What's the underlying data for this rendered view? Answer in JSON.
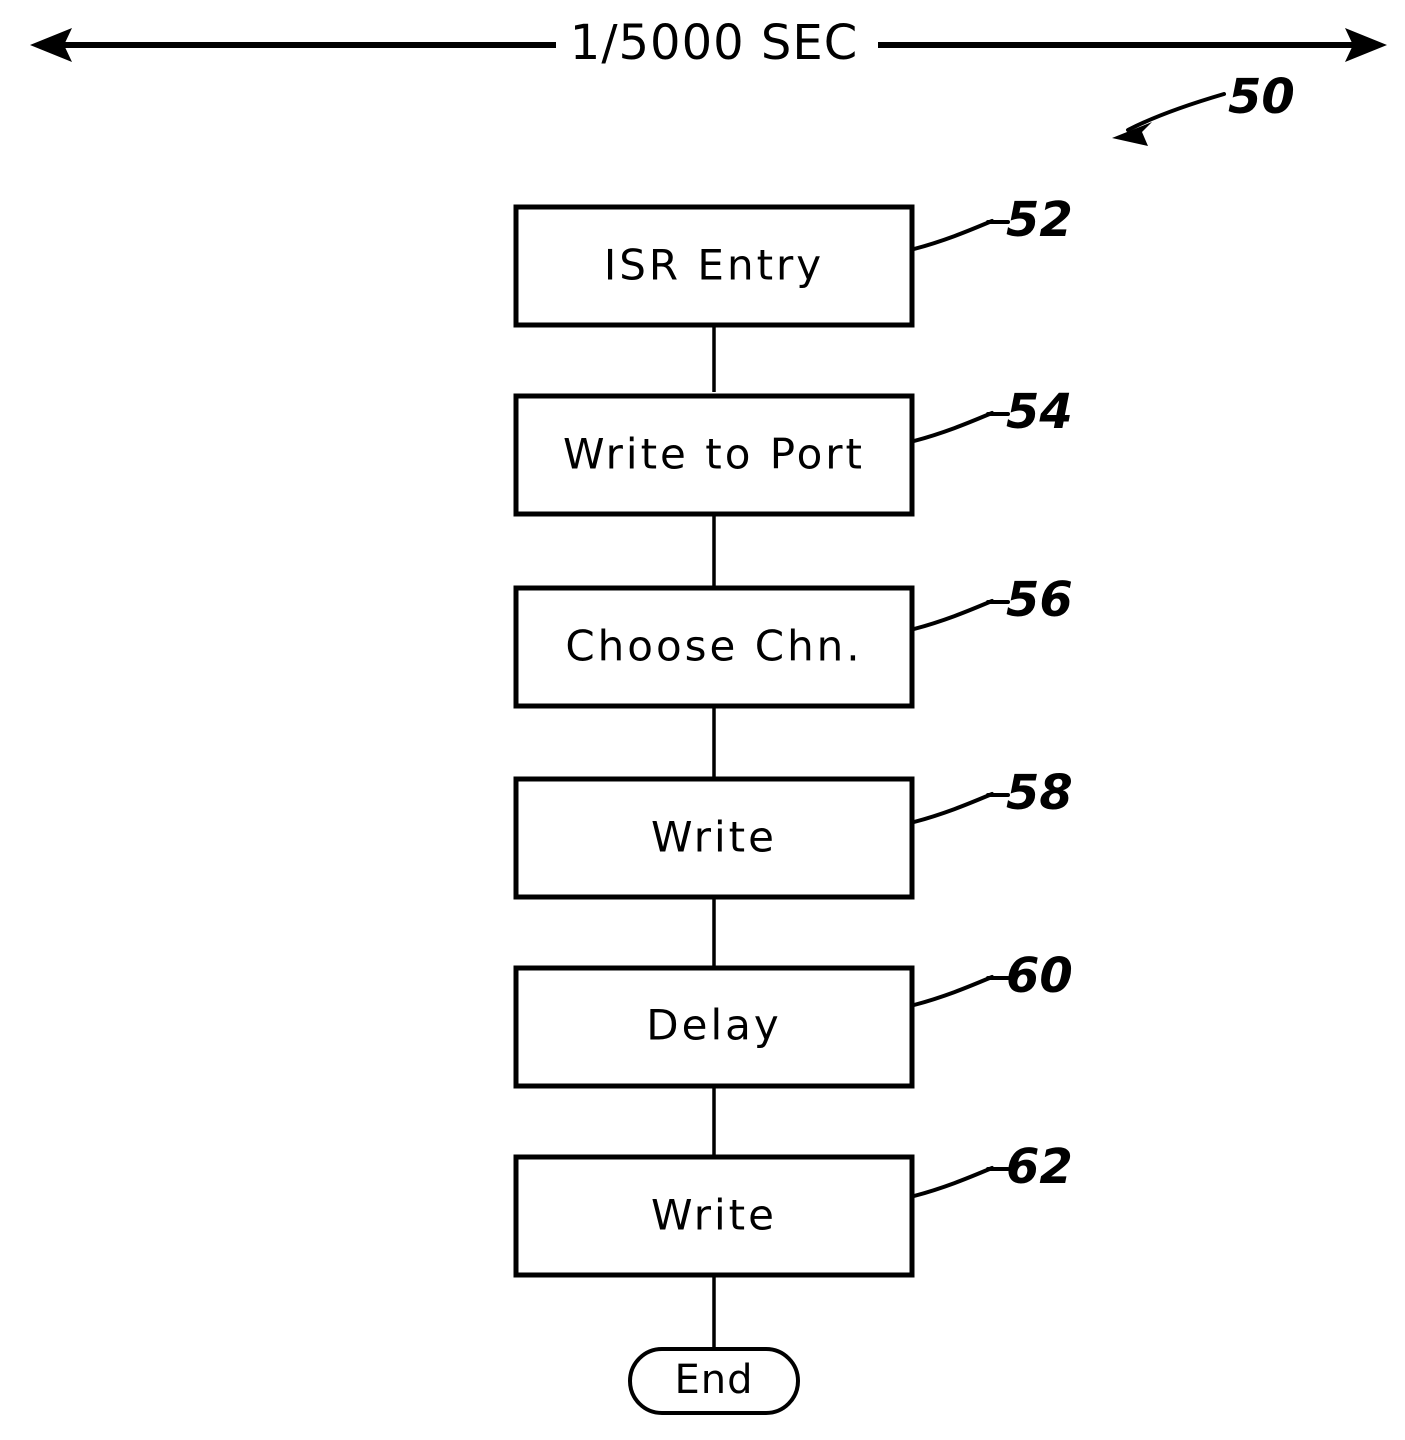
{
  "figure": {
    "reference_numeral": "50",
    "timing_label": "1/5000 SEC",
    "end_label": "End"
  },
  "flow": {
    "nodes": [
      {
        "id": "isr-entry",
        "label": "ISR Entry",
        "ref": "52",
        "shape": "process"
      },
      {
        "id": "write-to-port",
        "label": "Write to Port",
        "ref": "54",
        "shape": "process"
      },
      {
        "id": "choose-chn",
        "label": "Choose Chn.",
        "ref": "56",
        "shape": "process"
      },
      {
        "id": "write-1",
        "label": "Write",
        "ref": "58",
        "shape": "process"
      },
      {
        "id": "delay",
        "label": "Delay",
        "ref": "60",
        "shape": "process"
      },
      {
        "id": "write-2",
        "label": "Write",
        "ref": "62",
        "shape": "process"
      },
      {
        "id": "end",
        "label": "End",
        "ref": "",
        "shape": "terminator"
      }
    ],
    "edges": [
      {
        "from": "isr-entry",
        "to": "write-to-port"
      },
      {
        "from": "write-to-port",
        "to": "choose-chn"
      },
      {
        "from": "choose-chn",
        "to": "write-1"
      },
      {
        "from": "write-1",
        "to": "delay"
      },
      {
        "from": "delay",
        "to": "write-2"
      },
      {
        "from": "write-2",
        "to": "end"
      }
    ]
  },
  "colors": {
    "ink": "#000000",
    "paper": "#ffffff"
  }
}
